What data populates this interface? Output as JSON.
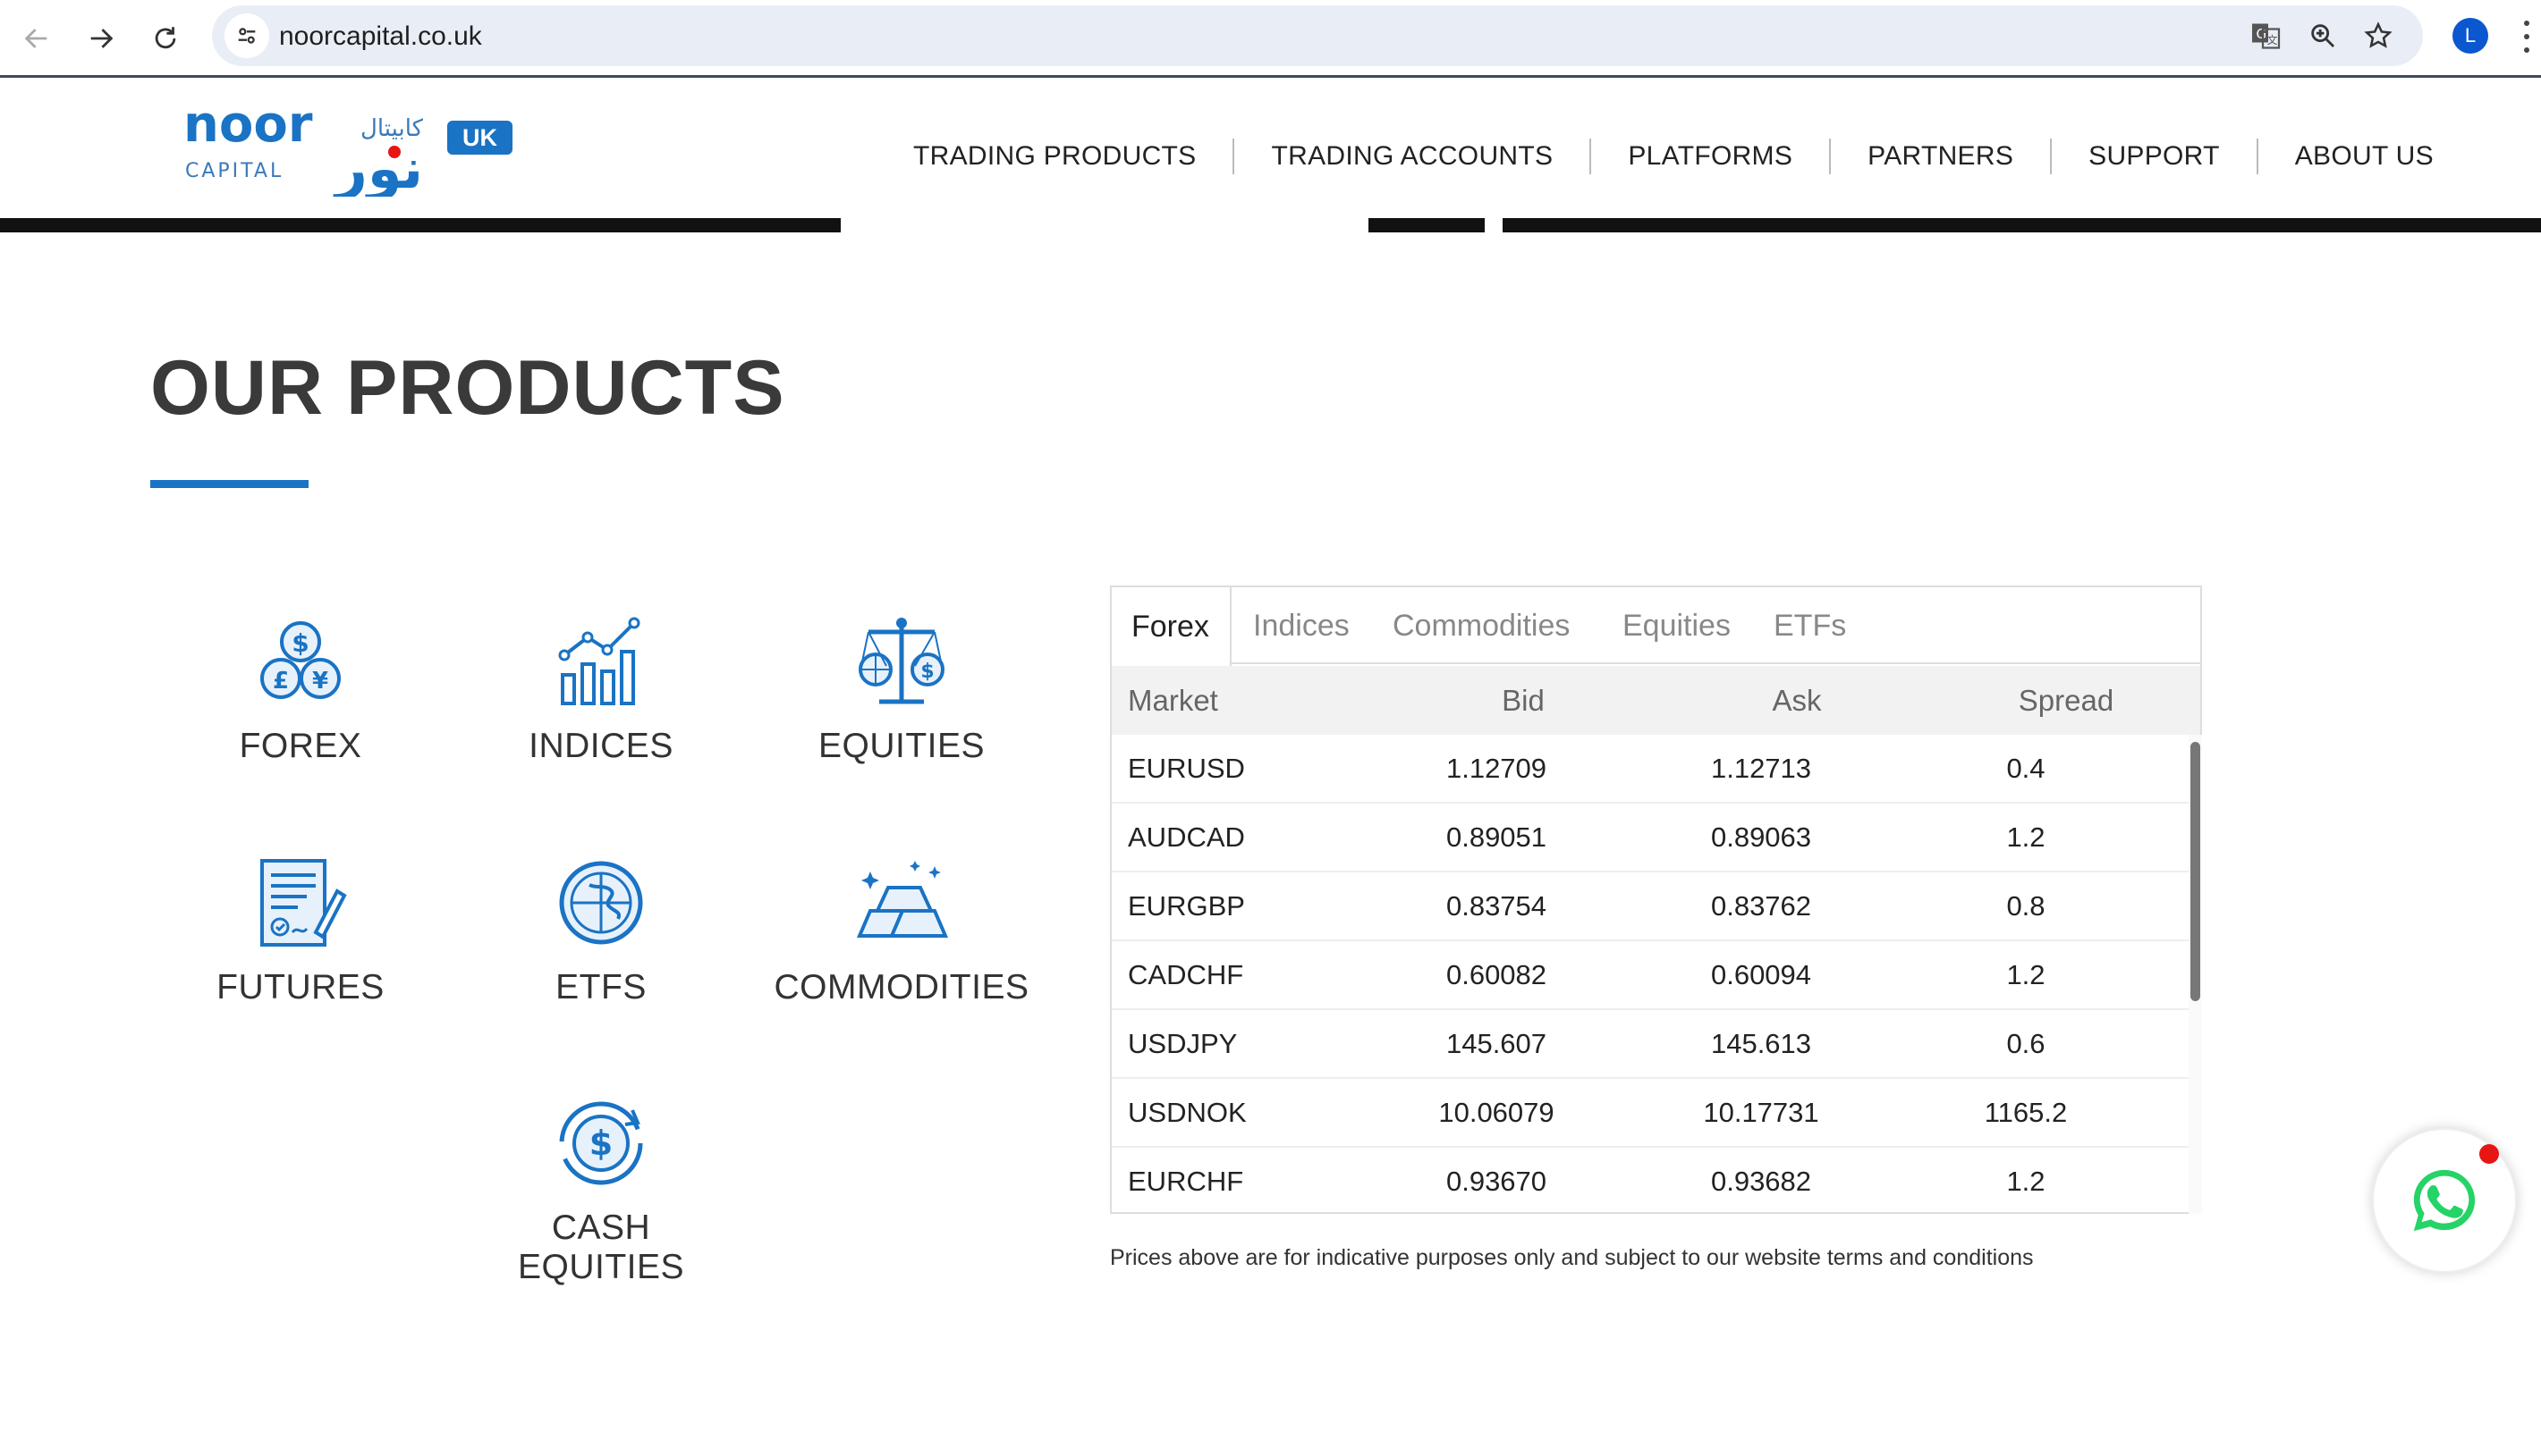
{
  "browser": {
    "url": "noorcapital.co.uk",
    "profile_initial": "L"
  },
  "header": {
    "logo_text_latin": "noor",
    "logo_text_capital": "CAPITAL",
    "logo_text_arabic": "كابيتال",
    "logo_text_arabic_big": "نور",
    "region_badge": "UK",
    "nav_items": [
      "TRADING PRODUCTS",
      "TRADING ACCOUNTS",
      "PLATFORMS",
      "PARTNERS",
      "SUPPORT",
      "ABOUT US"
    ]
  },
  "products": {
    "title": "OUR PRODUCTS",
    "items": [
      {
        "label": "FOREX",
        "icon": "currency-coins-icon"
      },
      {
        "label": "INDICES",
        "icon": "bar-chart-trend-icon"
      },
      {
        "label": "EQUITIES",
        "icon": "balance-scale-icon"
      },
      {
        "label": "FUTURES",
        "icon": "contract-pen-icon"
      },
      {
        "label": "ETFS",
        "icon": "globe-network-icon"
      },
      {
        "label": "COMMODITIES",
        "icon": "gold-bars-icon"
      },
      {
        "label": "CASH EQUITIES",
        "icon": "dollar-cycle-icon"
      }
    ]
  },
  "quotes": {
    "tabs": [
      "Forex",
      "Indices",
      "Commodities",
      "Equities",
      "ETFs"
    ],
    "active_tab": "Forex",
    "columns": [
      "Market",
      "Bid",
      "Ask",
      "Spread"
    ],
    "rows": [
      {
        "market": "EURUSD",
        "bid": "1.12709",
        "ask": "1.12713",
        "spread": "0.4"
      },
      {
        "market": "AUDCAD",
        "bid": "0.89051",
        "ask": "0.89063",
        "spread": "1.2"
      },
      {
        "market": "EURGBP",
        "bid": "0.83754",
        "ask": "0.83762",
        "spread": "0.8"
      },
      {
        "market": "CADCHF",
        "bid": "0.60082",
        "ask": "0.60094",
        "spread": "1.2"
      },
      {
        "market": "USDJPY",
        "bid": "145.607",
        "ask": "145.613",
        "spread": "0.6"
      },
      {
        "market": "USDNOK",
        "bid": "10.06079",
        "ask": "10.17731",
        "spread": "1165.2"
      },
      {
        "market": "EURCHF",
        "bid": "0.93670",
        "ask": "0.93682",
        "spread": "1.2"
      }
    ],
    "disclaimer": "Prices above are for indicative purposes only and subject to our website terms and conditions"
  },
  "colors": {
    "brand_blue": "#1a73c4",
    "whatsapp_green": "#25d366",
    "notification_red": "#e81515"
  }
}
